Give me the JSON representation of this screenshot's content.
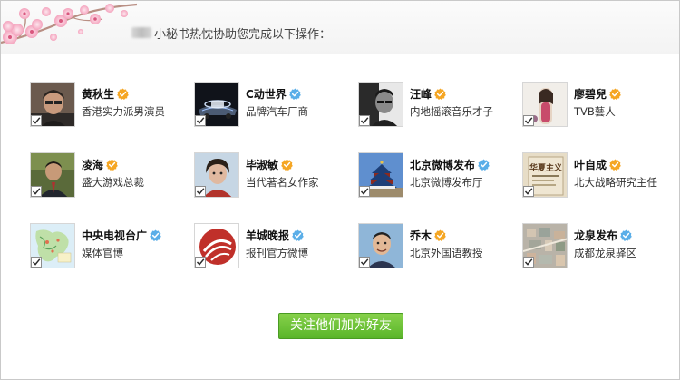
{
  "header": {
    "title": "小秘书热忱协助您完成以下操作："
  },
  "colors": {
    "verified_orange": "#f5a623",
    "verified_blue": "#5aaee8",
    "button_green": "#6cc23a"
  },
  "users": [
    {
      "name": "黄秋生",
      "desc": "香港实力派男演员",
      "badge": "orange",
      "checked": true,
      "avatar": "man-portrait-dark"
    },
    {
      "name": "C动世界",
      "desc": "品牌汽车厂商",
      "badge": "blue",
      "checked": true,
      "avatar": "car-logo"
    },
    {
      "name": "汪峰",
      "desc": "内地摇滚音乐才子",
      "badge": "orange",
      "checked": true,
      "avatar": "man-bw-portrait"
    },
    {
      "name": "廖碧兒",
      "desc": "TVB藝人",
      "badge": "orange",
      "checked": true,
      "avatar": "woman-photo"
    },
    {
      "name": "凌海",
      "desc": "盛大游戏总裁",
      "badge": "orange",
      "checked": true,
      "avatar": "man-suit"
    },
    {
      "name": "毕淑敏",
      "desc": "当代著名女作家",
      "badge": "orange",
      "checked": true,
      "avatar": "woman-portrait"
    },
    {
      "name": "北京微博发布",
      "desc": "北京微博发布厅",
      "badge": "blue",
      "checked": true,
      "avatar": "temple-of-heaven"
    },
    {
      "name": "叶自成",
      "desc": "北大战略研究主任",
      "badge": "orange",
      "checked": true,
      "avatar": "book-cover"
    },
    {
      "name": "中央电视台广",
      "desc": "媒体官博",
      "badge": "blue",
      "checked": true,
      "avatar": "map-image"
    },
    {
      "name": "羊城晚报",
      "desc": "报刊官方微博",
      "badge": "blue",
      "checked": true,
      "avatar": "newspaper-logo"
    },
    {
      "name": "乔木",
      "desc": "北京外国语教授",
      "badge": "orange",
      "checked": true,
      "avatar": "man-smiling"
    },
    {
      "name": "龙泉发布",
      "desc": "成都龙泉驿区",
      "badge": "blue",
      "checked": true,
      "avatar": "town-aerial"
    }
  ],
  "book_cover_text": "华夏主义",
  "follow_button": {
    "label": "关注他们加为好友"
  }
}
